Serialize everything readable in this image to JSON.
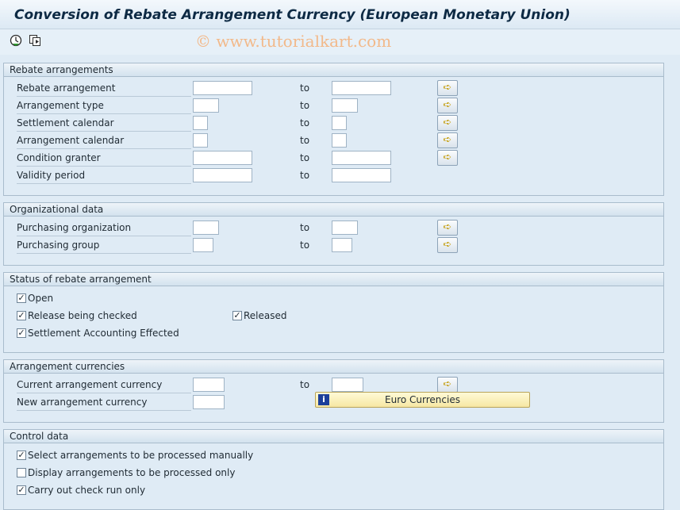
{
  "window": {
    "title": "Conversion of Rebate Arrangement Currency (European Monetary Union)"
  },
  "toolbar": {
    "execute_icon": "execute-icon",
    "variant_icon": "get-variant-icon"
  },
  "watermark": "© www.tutorialkart.com",
  "to_label": "to",
  "groups": {
    "rebate": {
      "title": "Rebate arrangements",
      "rows": [
        {
          "label": "Rebate arrangement"
        },
        {
          "label": "Arrangement type"
        },
        {
          "label": "Settlement calendar"
        },
        {
          "label": "Arrangement calendar"
        },
        {
          "label": "Condition granter"
        },
        {
          "label": "Validity period"
        }
      ]
    },
    "org": {
      "title": "Organizational data",
      "rows": [
        {
          "label": "Purchasing organization"
        },
        {
          "label": "Purchasing group"
        }
      ]
    },
    "status": {
      "title": "Status of rebate arrangement",
      "checks": [
        {
          "label": "Open",
          "checked": true
        },
        {
          "label": "Release being checked",
          "checked": true
        },
        {
          "label": "Released",
          "checked": true
        },
        {
          "label": "Settlement Accounting Effected",
          "checked": true
        }
      ]
    },
    "currency": {
      "title": "Arrangement currencies",
      "rows": [
        {
          "label": "Current arrangement currency"
        },
        {
          "label": "New arrangement currency"
        }
      ],
      "euro_button": "Euro Currencies"
    },
    "control": {
      "title": "Control data",
      "checks": [
        {
          "label": "Select arrangements to be processed manually",
          "checked": true
        },
        {
          "label": "Display arrangements to be processed only",
          "checked": false
        },
        {
          "label": "Carry out check run only",
          "checked": true
        }
      ]
    }
  }
}
